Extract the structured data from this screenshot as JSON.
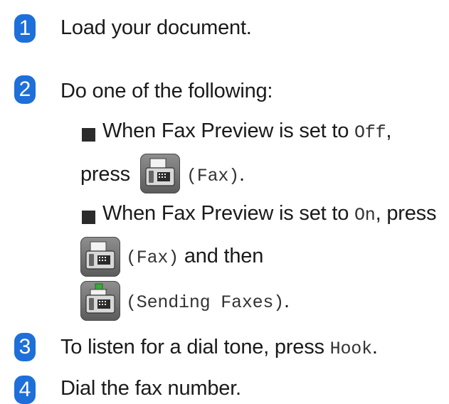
{
  "steps": [
    {
      "number": "1",
      "text": "Load your document."
    },
    {
      "number": "2",
      "text": "Do one of the following:"
    },
    {
      "number": "3",
      "text_prefix": "To listen for a dial tone, press ",
      "text_code": "Hook",
      "text_suffix": "."
    },
    {
      "number": "4",
      "text": "Dial the fax number."
    }
  ],
  "bullets": [
    {
      "line1_prefix": "When Fax Preview is set to ",
      "line1_code": "Off",
      "line1_suffix": ",",
      "line2_press": "press",
      "line2_code": "(Fax)",
      "line2_suffix": "."
    },
    {
      "line1_prefix": "When Fax Preview is set to ",
      "line1_code": "On",
      "line1_suffix": ", press",
      "line2_code": "(Fax)",
      "line2_suffix": " and then",
      "line3_code": "(Sending Faxes)",
      "line3_suffix": "."
    }
  ],
  "colors": {
    "step_badge": "#1e6fd9",
    "icon_background": "#707070",
    "send_arrow": "#3aa83a"
  },
  "icons": {
    "fax": "fax-icon",
    "sending_faxes": "sending-faxes-icon",
    "bullet": "square-bullet"
  }
}
